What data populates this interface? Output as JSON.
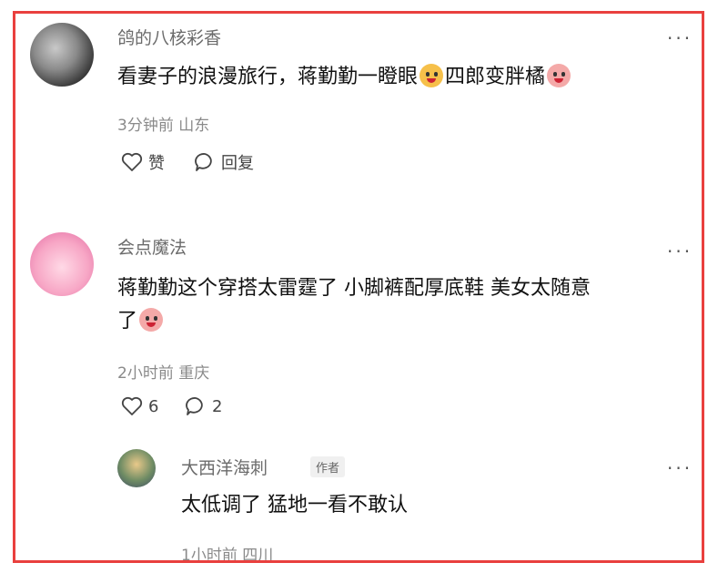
{
  "comments": [
    {
      "author": "鸽的八核彩香",
      "text": "看妻子的浪漫旅行，蒋勤勤一瞪眼",
      "text_after_emoji": "四郎变胖橘",
      "meta": "3分钟前  山东",
      "like_label": "赞",
      "reply_label": "回复"
    },
    {
      "author": "会点魔法",
      "text_line1": "蒋勤勤这个穿搭太雷霆了 小脚裤配厚底鞋 美女太随意",
      "text_line2": "了",
      "meta": "2小时前  重庆",
      "like_count": "6",
      "reply_count": "2"
    }
  ],
  "reply": {
    "author": "大西洋海刺",
    "author_tag": "作者",
    "text": "太低调了 猛地一看不敢认",
    "meta": "1小时前  四川"
  },
  "more_label": "···",
  "colors": {
    "frame": "#e9403e",
    "name": "#6b6b6b",
    "meta": "#8a8a8a"
  }
}
